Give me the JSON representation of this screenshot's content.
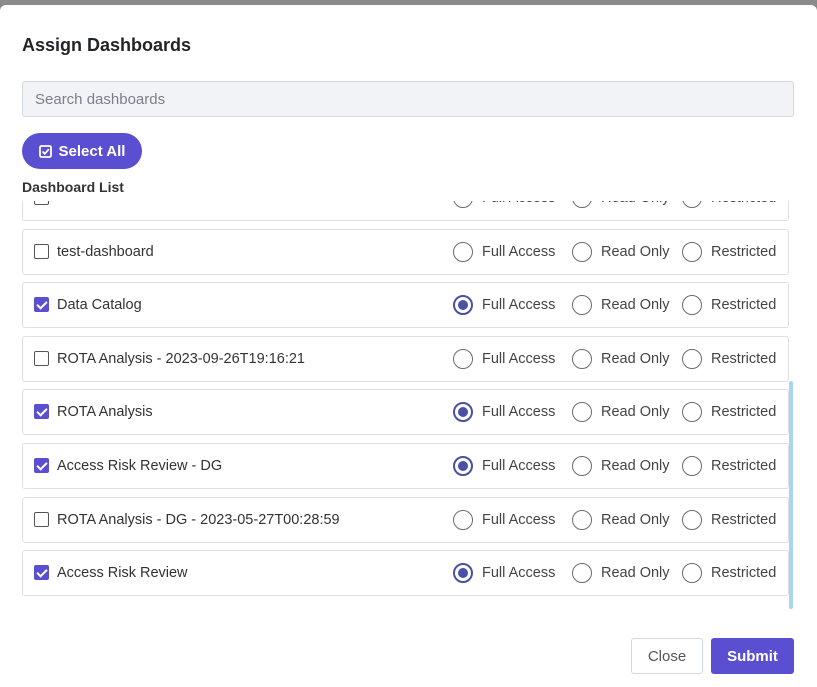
{
  "modal": {
    "title": "Assign Dashboards",
    "search": {
      "placeholder": "Search dashboards",
      "value": ""
    },
    "select_all_label": "Select All",
    "list_label": "Dashboard List",
    "access_options": [
      "Full Access",
      "Read Only",
      "Restricted"
    ],
    "rows": [
      {
        "name": "",
        "checked": false,
        "access": ""
      },
      {
        "name": "test-dashboard",
        "checked": false,
        "access": ""
      },
      {
        "name": "Data Catalog",
        "checked": true,
        "access": "Full Access"
      },
      {
        "name": "ROTA Analysis - 2023-09-26T19:16:21",
        "checked": false,
        "access": ""
      },
      {
        "name": "ROTA Analysis",
        "checked": true,
        "access": "Full Access"
      },
      {
        "name": "Access Risk Review - DG",
        "checked": true,
        "access": "Full Access"
      },
      {
        "name": "ROTA Analysis - DG - 2023-05-27T00:28:59",
        "checked": false,
        "access": ""
      },
      {
        "name": "Access Risk Review",
        "checked": true,
        "access": "Full Access"
      }
    ],
    "buttons": {
      "close": "Close",
      "submit": "Submit"
    },
    "colors": {
      "accent": "#5b4fd1",
      "radio_selected": "#4b4fa8",
      "scrollbar": "#a9d6ee"
    },
    "icons": {
      "select_all": "check-square-icon"
    }
  }
}
